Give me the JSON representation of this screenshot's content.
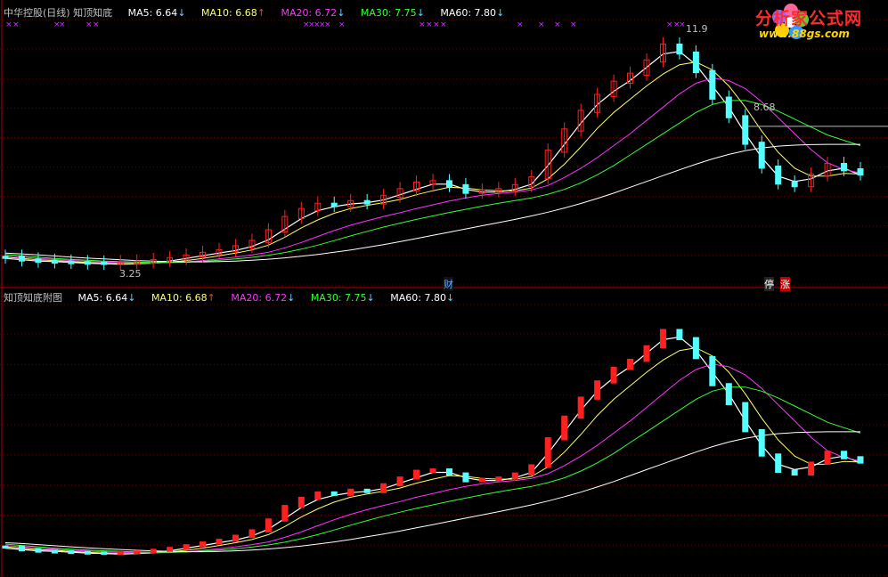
{
  "top_panel": {
    "title": "中华控股(日线) 知顶知底",
    "ma5": "MA5: 6.64",
    "ma5_arrow": "↓",
    "ma10": "MA10: 6.68",
    "ma10_arrow": "↑",
    "ma20": "MA20: 6.72",
    "ma20_arrow": "↓",
    "ma30": "MA30: 7.75",
    "ma30_arrow": "↓",
    "ma60": "MA60: 7.80",
    "ma60_arrow": "↓",
    "high_label": "11.9",
    "low_label": "3.25",
    "ref_label": "8.68",
    "event_cai": "财",
    "event_ting": "停",
    "event_zhang": "涨"
  },
  "bottom_panel": {
    "title": "知顶知底附图",
    "ma5": "MA5: 6.64",
    "ma5_arrow": "↓",
    "ma10": "MA10: 6.68",
    "ma10_arrow": "↑",
    "ma20": "MA20: 6.72",
    "ma20_arrow": "↓",
    "ma30": "MA30: 7.75",
    "ma30_arrow": "↓",
    "ma60": "MA60: 7.80",
    "ma60_arrow": "↓"
  },
  "logo": {
    "text": "分析家公式网",
    "url_text": "www.88gs.com"
  },
  "colors": {
    "up": "#ff2020",
    "down": "#55ffff",
    "ma5": "#ffffff",
    "ma10": "#ffff66",
    "ma20": "#ff33ff",
    "ma30": "#33ff33",
    "ma60": "#ffffff",
    "grid": "#5a0000",
    "sep": "#b00000"
  },
  "chart_data": [
    {
      "type": "line",
      "title": "中华控股(日线) 知顶知底",
      "xlabel": "",
      "ylabel": "",
      "ylim": [
        2.5,
        12.5
      ],
      "grid": true,
      "series": [
        {
          "name": "MA5",
          "values": [
            3.5,
            3.45,
            3.4,
            3.38,
            3.35,
            3.32,
            3.3,
            3.28,
            3.3,
            3.35,
            3.4,
            3.5,
            3.6,
            3.7,
            3.8,
            3.95,
            4.2,
            4.6,
            5.0,
            5.3,
            5.45,
            5.55,
            5.6,
            5.7,
            5.9,
            6.1,
            6.3,
            6.3,
            6.1,
            6.0,
            6.0,
            6.1,
            6.3,
            7.0,
            7.8,
            8.6,
            9.3,
            9.8,
            10.2,
            10.7,
            11.2,
            11.3,
            10.8,
            10.0,
            9.2,
            8.2,
            7.3,
            6.6,
            6.4,
            6.5,
            6.8,
            6.9,
            6.64
          ]
        },
        {
          "name": "MA10",
          "values": [
            3.55,
            3.5,
            3.45,
            3.42,
            3.38,
            3.35,
            3.32,
            3.3,
            3.3,
            3.32,
            3.36,
            3.42,
            3.5,
            3.6,
            3.7,
            3.82,
            4.0,
            4.3,
            4.65,
            4.95,
            5.2,
            5.38,
            5.5,
            5.6,
            5.72,
            5.9,
            6.05,
            6.18,
            6.15,
            6.08,
            6.05,
            6.05,
            6.15,
            6.5,
            7.05,
            7.7,
            8.4,
            9.0,
            9.5,
            10.0,
            10.45,
            10.8,
            10.9,
            10.6,
            10.0,
            9.2,
            8.3,
            7.5,
            6.9,
            6.6,
            6.6,
            6.7,
            6.68
          ]
        },
        {
          "name": "MA20",
          "values": [
            3.6,
            3.55,
            3.5,
            3.46,
            3.42,
            3.39,
            3.36,
            3.34,
            3.33,
            3.33,
            3.34,
            3.37,
            3.42,
            3.48,
            3.55,
            3.63,
            3.73,
            3.9,
            4.1,
            4.33,
            4.55,
            4.75,
            4.92,
            5.08,
            5.22,
            5.38,
            5.52,
            5.66,
            5.78,
            5.88,
            5.95,
            6.0,
            6.08,
            6.25,
            6.55,
            6.9,
            7.3,
            7.75,
            8.2,
            8.7,
            9.2,
            9.7,
            10.1,
            10.3,
            10.2,
            9.9,
            9.4,
            8.8,
            8.2,
            7.6,
            7.1,
            6.85,
            6.72
          ]
        },
        {
          "name": "MA30",
          "values": [
            3.65,
            3.6,
            3.55,
            3.5,
            3.46,
            3.43,
            3.4,
            3.38,
            3.36,
            3.35,
            3.35,
            3.36,
            3.39,
            3.43,
            3.48,
            3.54,
            3.62,
            3.72,
            3.85,
            4.0,
            4.17,
            4.35,
            4.52,
            4.68,
            4.83,
            4.97,
            5.1,
            5.23,
            5.35,
            5.47,
            5.58,
            5.68,
            5.78,
            5.92,
            6.1,
            6.35,
            6.65,
            7.0,
            7.4,
            7.8,
            8.2,
            8.6,
            9.0,
            9.3,
            9.45,
            9.45,
            9.3,
            9.05,
            8.75,
            8.45,
            8.15,
            7.95,
            7.75
          ]
        },
        {
          "name": "MA60",
          "values": [
            3.7,
            3.67,
            3.63,
            3.59,
            3.55,
            3.51,
            3.48,
            3.45,
            3.42,
            3.4,
            3.38,
            3.37,
            3.37,
            3.38,
            3.4,
            3.43,
            3.47,
            3.52,
            3.58,
            3.65,
            3.73,
            3.82,
            3.92,
            4.02,
            4.13,
            4.25,
            4.37,
            4.49,
            4.61,
            4.73,
            4.85,
            4.97,
            5.1,
            5.24,
            5.4,
            5.57,
            5.76,
            5.96,
            6.18,
            6.4,
            6.62,
            6.84,
            7.05,
            7.25,
            7.42,
            7.56,
            7.66,
            7.73,
            7.77,
            7.79,
            7.8,
            7.8,
            7.8
          ]
        }
      ],
      "candles_close": [
        3.5,
        3.4,
        3.35,
        3.32,
        3.3,
        3.28,
        3.27,
        3.3,
        3.32,
        3.38,
        3.45,
        3.55,
        3.65,
        3.75,
        3.9,
        4.1,
        4.5,
        5.0,
        5.3,
        5.5,
        5.45,
        5.6,
        5.55,
        5.8,
        6.05,
        6.3,
        6.35,
        6.2,
        5.95,
        6.0,
        6.05,
        6.2,
        6.5,
        7.5,
        8.3,
        9.0,
        9.6,
        10.1,
        10.4,
        10.9,
        11.5,
        11.2,
        10.5,
        9.5,
        8.8,
        7.8,
        6.9,
        6.3,
        6.2,
        6.6,
        7.0,
        6.8,
        6.64
      ],
      "candles_up": [
        0,
        0,
        0,
        0,
        0,
        0,
        0,
        1,
        1,
        1,
        1,
        1,
        1,
        1,
        1,
        1,
        1,
        1,
        1,
        1,
        0,
        1,
        0,
        1,
        1,
        1,
        1,
        0,
        0,
        1,
        1,
        1,
        1,
        1,
        1,
        1,
        1,
        1,
        1,
        1,
        1,
        0,
        0,
        0,
        0,
        0,
        0,
        0,
        0,
        1,
        1,
        0,
        0
      ],
      "annotations": [
        "11.9",
        "3.25",
        "8.68",
        "财",
        "停",
        "涨"
      ]
    },
    {
      "type": "line",
      "title": "知顶知底附图",
      "ylim": [
        2.5,
        12.5
      ],
      "grid": true,
      "series_ref": "same MA values as top panel",
      "bars_close": [
        3.5,
        3.4,
        3.35,
        3.32,
        3.3,
        3.28,
        3.27,
        3.3,
        3.32,
        3.38,
        3.45,
        3.55,
        3.65,
        3.75,
        3.9,
        4.1,
        4.5,
        5.0,
        5.3,
        5.5,
        5.45,
        5.6,
        5.55,
        5.8,
        6.05,
        6.3,
        6.35,
        6.2,
        5.95,
        6.0,
        6.05,
        6.2,
        6.5,
        7.5,
        8.3,
        9.0,
        9.6,
        10.1,
        10.4,
        10.9,
        11.5,
        11.2,
        10.5,
        9.5,
        8.8,
        7.8,
        6.9,
        6.3,
        6.2,
        6.6,
        7.0,
        6.8,
        6.64
      ]
    }
  ]
}
